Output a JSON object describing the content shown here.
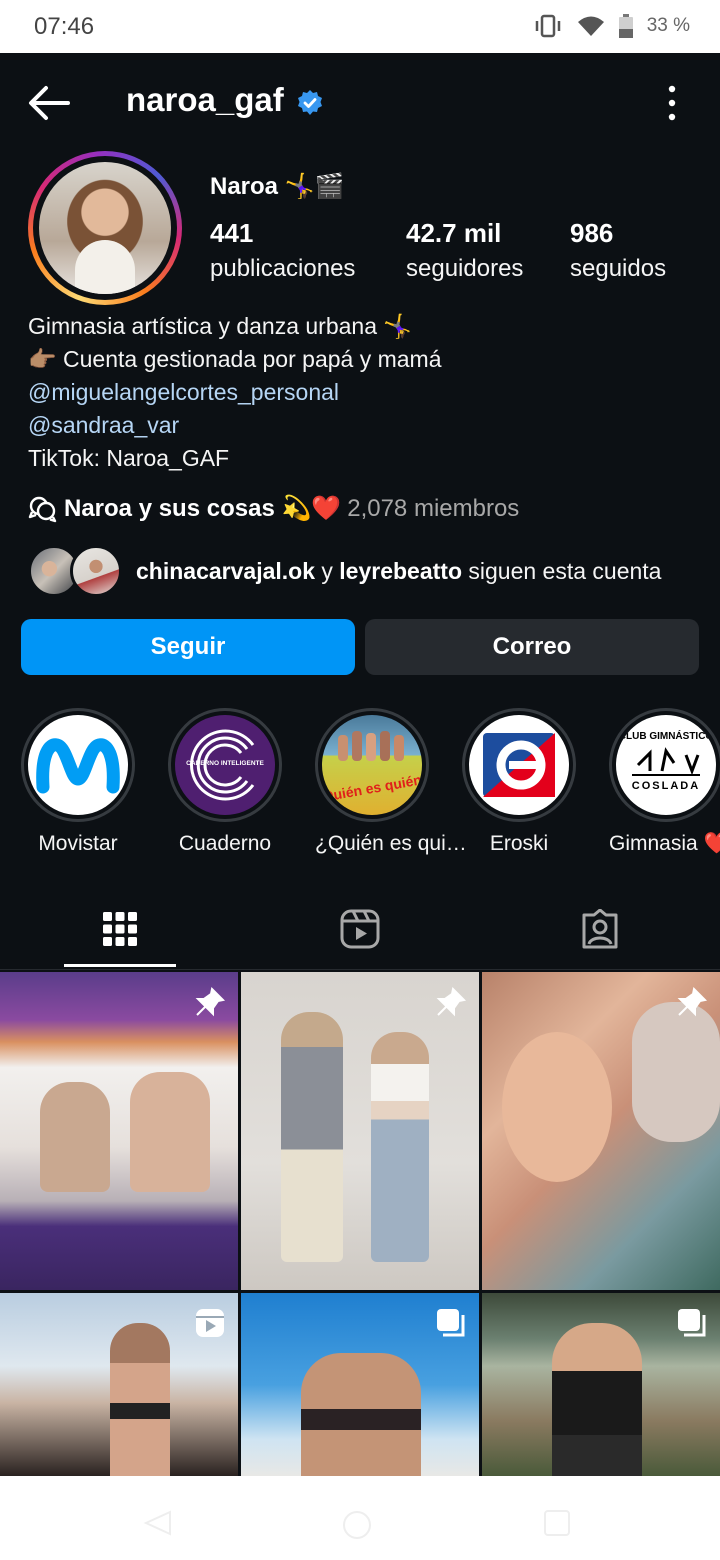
{
  "status_bar": {
    "time": "07:46",
    "battery": "33 %"
  },
  "header": {
    "username": "naroa_gaf"
  },
  "profile": {
    "display_name": "Naroa 🤸‍♀️🎬",
    "stats": [
      {
        "value": "441",
        "label": "publicaciones"
      },
      {
        "value": "42.7 mil",
        "label": "seguidores"
      },
      {
        "value": "986",
        "label": "seguidos"
      }
    ],
    "bio": {
      "line1": "Gimnasia artística y danza urbana 🤸‍♀️",
      "line2": "👉🏽 Cuenta gestionada por papá y mamá",
      "link1": "@miguelangelcortes_personal",
      "link2": "@sandraa_var",
      "line5": "TikTok: Naroa_GAF"
    },
    "channel": {
      "name": "Naroa y sus cosas 💫❤️",
      "members": "2,078 miembros"
    },
    "followed_by": {
      "user1": "chinacarvajal.ok",
      "conj": " y ",
      "user2": "leyrebeatto",
      "suffix": " siguen esta cuenta"
    }
  },
  "buttons": {
    "follow": "Seguir",
    "mail": "Correo"
  },
  "highlights": [
    {
      "label": "Movistar"
    },
    {
      "label": "Cuaderno"
    },
    {
      "label": "¿Quién es qui…"
    },
    {
      "label": "Eroski"
    },
    {
      "label": "Gimnasia ❤️"
    }
  ],
  "highlight_texts": {
    "cuaderno": "CADERNO INTELIGENTE",
    "quien": "¿Quién es quién?",
    "club": "CLUB GIMNÁSTICO",
    "coslada": "COSLADA"
  },
  "colors": {
    "accent": "#0095f6",
    "background": "#0c1014",
    "verified": "#3897f0"
  }
}
